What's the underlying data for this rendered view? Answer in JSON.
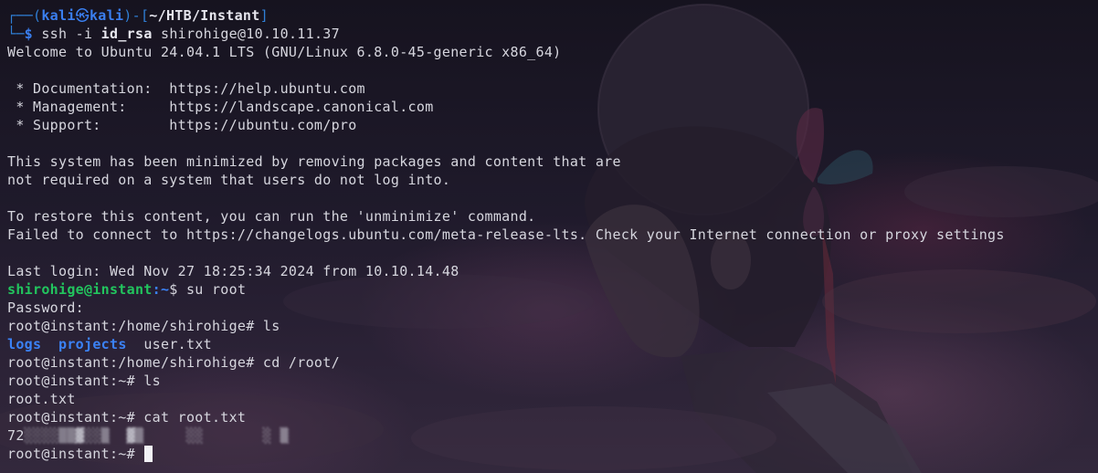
{
  "prompt": {
    "user": "kali",
    "host": "kali",
    "skull_glyph": "㉿",
    "path": "~/HTB/Instant",
    "command_prefix": "ssh -i ",
    "command_file": "id_rsa",
    "command_target": " shirohige@10.10.11.37"
  },
  "output": {
    "welcome": "Welcome to Ubuntu 24.04.1 LTS (GNU/Linux 6.8.0-45-generic x86_64)",
    "docs": " * Documentation:  https://help.ubuntu.com",
    "management": " * Management:     https://landscape.canonical.com",
    "support": " * Support:        https://ubuntu.com/pro",
    "minimized_1": "This system has been minimized by removing packages and content that are",
    "minimized_2": "not required on a system that users do not log into.",
    "restore": "To restore this content, you can run the 'unminimize' command.",
    "failed": "Failed to connect to https://changelogs.ubuntu.com/meta-release-lts. Check your Internet connection or proxy settings",
    "last_login": "Last login: Wed Nov 27 18:25:34 2024 from 10.10.14.48"
  },
  "session": {
    "ubuntu_user": "shirohige@instant",
    "ubuntu_path": ":~",
    "ubuntu_cmd": "$ su root",
    "password_prompt": "Password:",
    "root_home_prompt": "root@instant:/home/shirohige# ls",
    "ls_dir_1": "logs",
    "ls_dir_2": "projects",
    "ls_file_1": "user.txt",
    "cd_cmd": "root@instant:/home/shirohige# cd /root/",
    "root_ls": "root@instant:~# ls",
    "root_txt": "root.txt",
    "cat_cmd": "root@instant:~# cat root.txt",
    "flag_redacted": "72",
    "final_prompt": "root@instant:~# "
  },
  "colors": {
    "prompt_frame": "#2f7fd6",
    "ubuntu_user": "#22c55e",
    "directory": "#3b82f6",
    "text": "#d6d6de"
  }
}
